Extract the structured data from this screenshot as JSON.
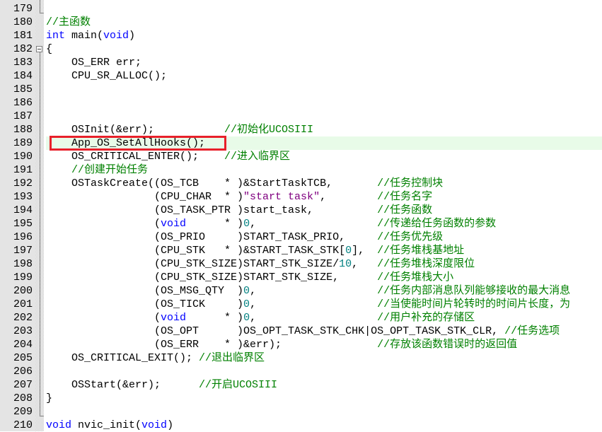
{
  "editor": {
    "colors": {
      "keyword": "#0000ff",
      "comment": "#008000",
      "string": "#800080",
      "number": "#008080",
      "highlight_box": "#e8202a",
      "current_line": "#e8fbe8"
    },
    "highlighted_line": 189,
    "lines": [
      {
        "n": "179",
        "tokens": []
      },
      {
        "n": "180",
        "tokens": [
          [
            "c",
            "//主函数"
          ]
        ]
      },
      {
        "n": "181",
        "tokens": [
          [
            "k",
            "int"
          ],
          [
            "p",
            " main("
          ],
          [
            "k",
            "void"
          ],
          [
            "p",
            ")"
          ]
        ]
      },
      {
        "n": "182",
        "tokens": [
          [
            "p",
            "{"
          ]
        ]
      },
      {
        "n": "183",
        "tokens": [
          [
            "p",
            "    OS_ERR err;"
          ]
        ]
      },
      {
        "n": "184",
        "tokens": [
          [
            "p",
            "    CPU_SR_ALLOC();"
          ]
        ]
      },
      {
        "n": "185",
        "tokens": []
      },
      {
        "n": "186",
        "tokens": []
      },
      {
        "n": "187",
        "tokens": []
      },
      {
        "n": "188",
        "tokens": [
          [
            "p",
            "    OSInit(&err);           "
          ],
          [
            "c",
            "//初始化UCOSIII"
          ]
        ]
      },
      {
        "n": "189",
        "tokens": [
          [
            "p",
            "    App_OS_SetAllHooks();"
          ]
        ]
      },
      {
        "n": "190",
        "tokens": [
          [
            "p",
            "    OS_CRITICAL_ENTER();    "
          ],
          [
            "c",
            "//进入临界区"
          ]
        ]
      },
      {
        "n": "191",
        "tokens": [
          [
            "p",
            "    "
          ],
          [
            "c",
            "//创建开始任务"
          ]
        ]
      },
      {
        "n": "192",
        "tokens": [
          [
            "p",
            "    OSTaskCreate((OS_TCB    * )&StartTaskTCB,       "
          ],
          [
            "c",
            "//任务控制块"
          ]
        ]
      },
      {
        "n": "193",
        "tokens": [
          [
            "p",
            "                 (CPU_CHAR  * )"
          ],
          [
            "s",
            "\"start task\""
          ],
          [
            "p",
            ",        "
          ],
          [
            "c",
            "//任务名字"
          ]
        ]
      },
      {
        "n": "194",
        "tokens": [
          [
            "p",
            "                 (OS_TASK_PTR )start_task,          "
          ],
          [
            "c",
            "//任务函数"
          ]
        ]
      },
      {
        "n": "195",
        "tokens": [
          [
            "p",
            "                 ("
          ],
          [
            "k",
            "void"
          ],
          [
            "p",
            "      * )"
          ],
          [
            "n",
            "0"
          ],
          [
            "p",
            ",                   "
          ],
          [
            "c",
            "//传递给任务函数的参数"
          ]
        ]
      },
      {
        "n": "196",
        "tokens": [
          [
            "p",
            "                 (OS_PRIO     )START_TASK_PRIO,     "
          ],
          [
            "c",
            "//任务优先级"
          ]
        ]
      },
      {
        "n": "197",
        "tokens": [
          [
            "p",
            "                 (CPU_STK   * )&START_TASK_STK["
          ],
          [
            "n",
            "0"
          ],
          [
            "p",
            "],  "
          ],
          [
            "c",
            "//任务堆栈基地址"
          ]
        ]
      },
      {
        "n": "198",
        "tokens": [
          [
            "p",
            "                 (CPU_STK_SIZE)START_STK_SIZE/"
          ],
          [
            "n",
            "10"
          ],
          [
            "p",
            ",   "
          ],
          [
            "c",
            "//任务堆栈深度限位"
          ]
        ]
      },
      {
        "n": "199",
        "tokens": [
          [
            "p",
            "                 (CPU_STK_SIZE)START_STK_SIZE,      "
          ],
          [
            "c",
            "//任务堆栈大小"
          ]
        ]
      },
      {
        "n": "200",
        "tokens": [
          [
            "p",
            "                 (OS_MSG_QTY  )"
          ],
          [
            "n",
            "0"
          ],
          [
            "p",
            ",                   "
          ],
          [
            "c",
            "//任务内部消息队列能够接收的最大消息"
          ]
        ]
      },
      {
        "n": "201",
        "tokens": [
          [
            "p",
            "                 (OS_TICK     )"
          ],
          [
            "n",
            "0"
          ],
          [
            "p",
            ",                   "
          ],
          [
            "c",
            "//当使能时间片轮转时的时间片长度，为"
          ]
        ]
      },
      {
        "n": "202",
        "tokens": [
          [
            "p",
            "                 ("
          ],
          [
            "k",
            "void"
          ],
          [
            "p",
            "      * )"
          ],
          [
            "n",
            "0"
          ],
          [
            "p",
            ",                   "
          ],
          [
            "c",
            "//用户补充的存储区"
          ]
        ]
      },
      {
        "n": "203",
        "tokens": [
          [
            "p",
            "                 (OS_OPT      )OS_OPT_TASK_STK_CHK|OS_OPT_TASK_STK_CLR, "
          ],
          [
            "c",
            "//任务选项"
          ]
        ]
      },
      {
        "n": "204",
        "tokens": [
          [
            "p",
            "                 (OS_ERR    * )&err);               "
          ],
          [
            "c",
            "//存放该函数错误时的返回值"
          ]
        ]
      },
      {
        "n": "205",
        "tokens": [
          [
            "p",
            "    OS_CRITICAL_EXIT(); "
          ],
          [
            "c",
            "//退出临界区"
          ]
        ]
      },
      {
        "n": "206",
        "tokens": []
      },
      {
        "n": "207",
        "tokens": [
          [
            "p",
            "    OSStart(&err);      "
          ],
          [
            "c",
            "//开启UCOSIII"
          ]
        ]
      },
      {
        "n": "208",
        "tokens": [
          [
            "p",
            "}"
          ]
        ]
      },
      {
        "n": "209",
        "tokens": []
      },
      {
        "n": "210",
        "tokens": [
          [
            "k",
            "void"
          ],
          [
            "p",
            " nvic_init("
          ],
          [
            "k",
            "void"
          ],
          [
            "p",
            ")"
          ]
        ]
      }
    ]
  }
}
